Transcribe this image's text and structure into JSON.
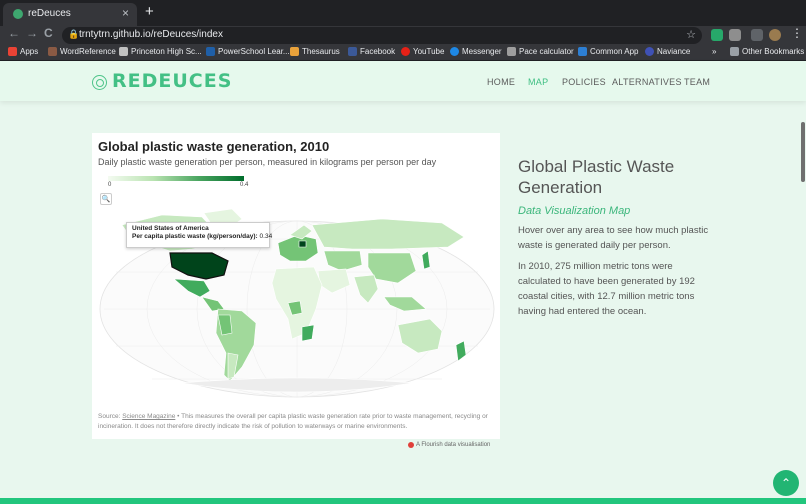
{
  "browser": {
    "tab_title": "reDeuces",
    "tab_close": "×",
    "new_tab": "+",
    "url": "trntytrn.github.io/reDeuces/index",
    "back": "←",
    "forward": "→",
    "reload": "C",
    "bookmark_star": "☆",
    "menu_dots": "⋮",
    "bookmarks": [
      "Apps",
      "WordReference",
      "Princeton High Sc...",
      "PowerSchool Lear...",
      "Thesaurus",
      "Facebook",
      "YouTube",
      "Messenger",
      "Pace calculator",
      "Common App",
      "Naviance"
    ],
    "more_bookmarks": "»",
    "other_bookmarks": "Other Bookmarks"
  },
  "site": {
    "logo": "REDEUCES",
    "nav": [
      {
        "label": "HOME",
        "active": false
      },
      {
        "label": "MAP",
        "active": true
      },
      {
        "label": "POLICIES",
        "active": false
      },
      {
        "label": "ALTERNATIVES",
        "active": false
      },
      {
        "label": "TEAM",
        "active": false
      }
    ]
  },
  "map": {
    "title": "Global plastic waste generation, 2010",
    "subtitle": "Daily plastic waste generation per person, measured in kilograms per person per day",
    "legend_min": "0",
    "legend_max": "0.4",
    "tooltip_country": "United States of America",
    "tooltip_label": "Per capita plastic waste (kg/person/day):",
    "tooltip_value": "0.34",
    "source_prefix": "Source:",
    "source_link": "Science Magazine",
    "source_text": "• This measures the overall per capita plastic waste generation rate prior to waste management, recycling or incineration. It does not therefore directly indicate the risk of pollution to waterways or marine environments.",
    "flourish": "A Flourish data visualisation",
    "zoom_icon": "🔍"
  },
  "info": {
    "title": "Global Plastic Waste Generation",
    "subtitle": "Data Visualization Map",
    "p1": "Hover over any area to see how much plastic waste is generated daily per person.",
    "p2": "In 2010, 275 million metric tons were calculated to have been generated by 192 coastal cities, with 12.7 million metric tons having had entered the ocean."
  },
  "fab_icon": "⌃",
  "colors": {
    "accent": "#43c085",
    "page_bg": "#e8f7ee",
    "map_dark": "#006d2c",
    "map_light": "#e5f5e0"
  }
}
